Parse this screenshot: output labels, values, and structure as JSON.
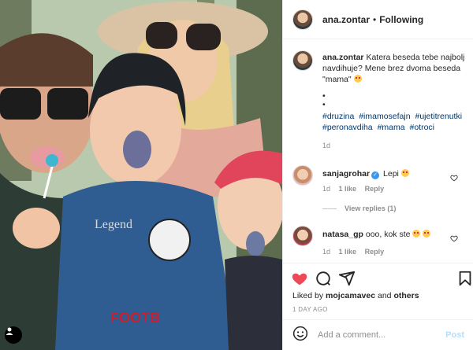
{
  "post": {
    "username": "ana.zontar",
    "follow_status": "Following",
    "separator": "•"
  },
  "caption": {
    "username": "ana.zontar",
    "text": "Katera beseda tebe najbolj navdihuje? Mene brez dvoma beseda \"mama\"",
    "bullet1": "•",
    "bullet2": "•",
    "hashtags": [
      "#druzina",
      "#imamosefajn",
      "#ujetitrenutki",
      "#peronavdiha",
      "#mama",
      "#otroci"
    ],
    "time": "1d"
  },
  "comments": [
    {
      "username": "sanjagrohar",
      "text": "Lepi",
      "time": "1d",
      "likes": "1 like",
      "reply": "Reply",
      "view_replies": "View replies (1)"
    },
    {
      "username": "natasa_gp",
      "text": "ooo, kok ste",
      "time": "1d",
      "likes": "1 like",
      "reply": "Reply"
    }
  ],
  "actions": {
    "icons": [
      "heart-icon",
      "comment-icon",
      "share-icon",
      "bookmark-icon"
    ],
    "liked_color": "#ed4956"
  },
  "likes": {
    "prefix": "Liked by",
    "user": "mojcamavec",
    "conjunction": "and",
    "others": "others"
  },
  "date": "1 DAY AGO",
  "composer": {
    "placeholder": "Add a comment...",
    "post_label": "Post",
    "emoji_icon": "smile-icon"
  },
  "colors": {
    "link": "#00376b",
    "muted": "#8e8e8e",
    "verified": "#3897f0",
    "post_disabled": "#b2dffc"
  }
}
